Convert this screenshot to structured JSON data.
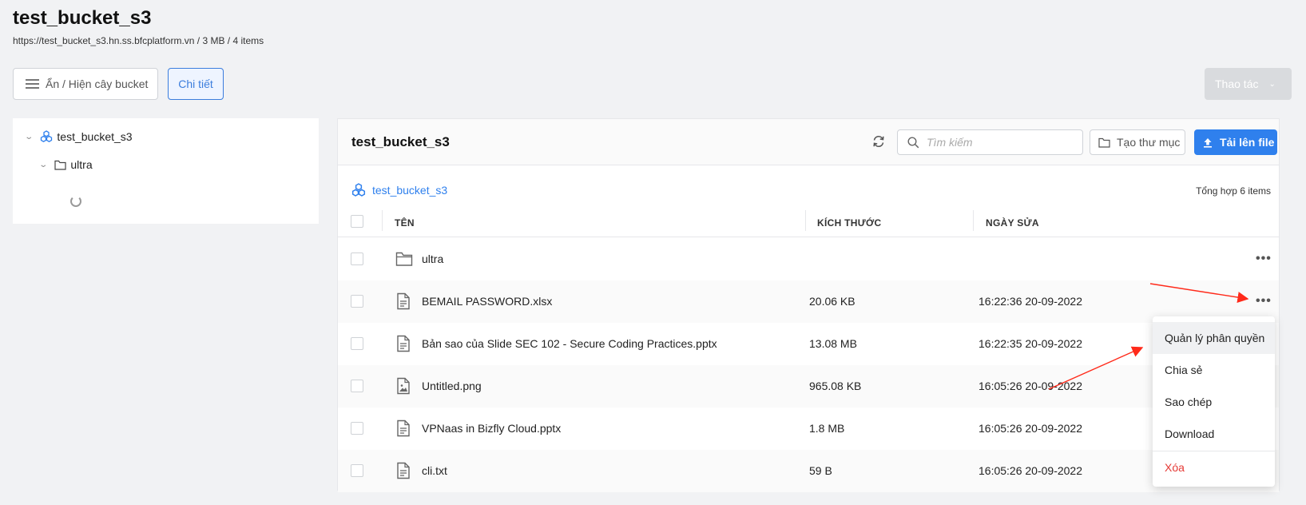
{
  "page": {
    "title": "test_bucket_s3",
    "subtitle": "https://test_bucket_s3.hn.ss.bfcplatform.vn / 3 MB / 4 items"
  },
  "toolbar": {
    "toggle_tree_label": "Ẩn / Hiện cây bucket",
    "detail_label": "Chi tiết",
    "action_label": "Thao tác"
  },
  "tree": {
    "root_label": "test_bucket_s3",
    "child_label": "ultra"
  },
  "main": {
    "title": "test_bucket_s3",
    "search_placeholder": "Tìm kiếm",
    "new_folder_label": "Tạo thư mục",
    "upload_label": "Tải lên file",
    "breadcrumb": "test_bucket_s3",
    "total": "Tổng hợp 6 items",
    "columns": {
      "name": "TÊN",
      "size": "KÍCH THƯỚC",
      "modified": "NGÀY SỬA"
    },
    "rows": [
      {
        "type": "folder",
        "name": "ultra",
        "size": "",
        "date": ""
      },
      {
        "type": "file",
        "name": "BEMAIL PASSWORD.xlsx",
        "size": "20.06 KB",
        "date": "16:22:36 20-09-2022"
      },
      {
        "type": "file",
        "name": "Bản sao của Slide SEC 102 - Secure Coding Practices.pptx",
        "size": "13.08 MB",
        "date": "16:22:35 20-09-2022"
      },
      {
        "type": "image",
        "name": "Untitled.png",
        "size": "965.08 KB",
        "date": "16:05:26 20-09-2022"
      },
      {
        "type": "file",
        "name": "VPNaas in Bizfly Cloud.pptx",
        "size": "1.8 MB",
        "date": "16:05:26 20-09-2022"
      },
      {
        "type": "file",
        "name": "cli.txt",
        "size": "59 B",
        "date": "16:05:26 20-09-2022"
      }
    ],
    "more_glyph": "•••"
  },
  "context_menu": {
    "items": [
      {
        "label": "Quản lý phân quyền",
        "active": true
      },
      {
        "label": "Chia sẻ"
      },
      {
        "label": "Sao chép"
      },
      {
        "label": "Download"
      },
      {
        "label": "Xóa",
        "danger": true
      }
    ]
  },
  "colors": {
    "accent": "#2f80ed",
    "danger": "#e53935",
    "annotation_arrow": "#ff2a1a"
  }
}
